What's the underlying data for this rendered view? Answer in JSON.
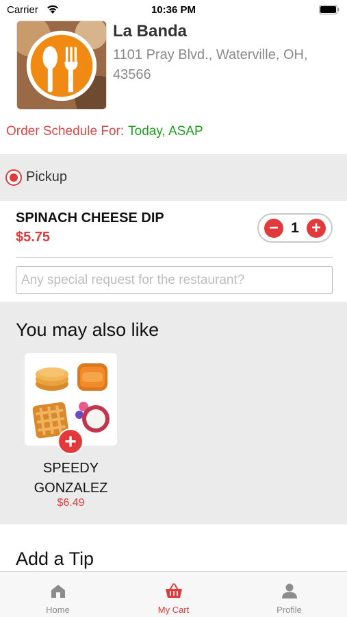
{
  "status_bar": {
    "carrier": "Carrier",
    "time": "10:36 PM"
  },
  "restaurant": {
    "name": "La Banda",
    "address": "1101 Pray Blvd., Waterville, OH, 43566"
  },
  "schedule": {
    "label": "Order Schedule For:",
    "value": "Today, ASAP"
  },
  "order_type": {
    "label": "Pickup",
    "selected": true
  },
  "cart_item": {
    "name": "SPINACH CHEESE DIP",
    "price": "$5.75",
    "quantity": "1",
    "minus_symbol": "−",
    "plus_symbol": "+"
  },
  "special_request": {
    "placeholder": "Any special request for the restaurant?",
    "value": ""
  },
  "recommendations": {
    "title": "You may also like",
    "items": [
      {
        "name": "SPEEDY GONZALEZ",
        "price": "$6.49",
        "add_symbol": "+"
      }
    ]
  },
  "tip": {
    "title": "Add a Tip"
  },
  "tab_bar": {
    "tabs": [
      {
        "label": "Home",
        "icon": "home-icon",
        "active": false
      },
      {
        "label": "My Cart",
        "icon": "basket-icon",
        "active": true
      },
      {
        "label": "Profile",
        "icon": "person-icon",
        "active": false
      }
    ]
  },
  "colors": {
    "accent": "#e23a3a",
    "success": "#1ea01e",
    "section_bg": "#ebebeb",
    "logo_orange": "#f08a12"
  }
}
